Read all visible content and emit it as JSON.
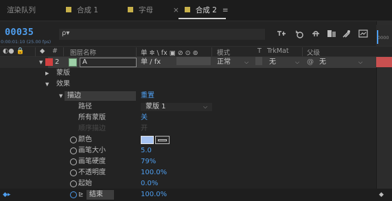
{
  "tabs": [
    {
      "label": "渲染队列"
    },
    {
      "label": "合成 1"
    },
    {
      "label": "字母"
    },
    {
      "label": "合成 2"
    }
  ],
  "active_tab_close": "×",
  "active_tab_menu": "≡",
  "swatch_color": "#c8b14a",
  "toolbar": {
    "timecode": "00035",
    "subtime": "0:00:01:10 (25.00 fps)",
    "search_placeholder": "",
    "search_glyph": "ρ▾",
    "icons": [
      "comp-flow-icon",
      "draft-3d-icon",
      "shy-icon",
      "frame-blend-icon",
      "motion-blur-icon",
      "graph-editor-icon"
    ]
  },
  "ruler_label": "0000",
  "header": {
    "source_name": "图层名称",
    "switches": "单 ✲ \\ fx ▣ ⊘ ⊙ ⊚",
    "mode": "模式",
    "t": "T",
    "trkmat": "TrkMat",
    "parent": "父级",
    "hash": "#"
  },
  "layer": {
    "number": "2",
    "name": "A",
    "mode_value": "正常",
    "trkmat_value": "无",
    "parent_value": "无",
    "switches": "单  / fx"
  },
  "tree": {
    "masks": "蒙版",
    "effects": "效果",
    "stroke": "描边",
    "reset": "重置"
  },
  "props": [
    {
      "label": "路径",
      "value": "蒙版 1",
      "dropdown": true
    },
    {
      "label": "所有蒙版",
      "value": "关"
    },
    {
      "label": "顺序描边",
      "value": "开",
      "disabled": true
    },
    {
      "label": "颜色",
      "value": ""
    },
    {
      "label": "画笔大小",
      "value": "5.0"
    },
    {
      "label": "画笔硬度",
      "value": "79%"
    },
    {
      "label": "不透明度",
      "value": "100.0%"
    },
    {
      "label": "起始",
      "value": "0.0%"
    },
    {
      "label": "结束",
      "value": "100.0%"
    }
  ],
  "colors": {
    "accent_blue": "#4f9ff0",
    "layer_label_red": "#d24040",
    "layer_color_green": "#9ed0a8",
    "stroke_color": "#a6c3f2"
  }
}
